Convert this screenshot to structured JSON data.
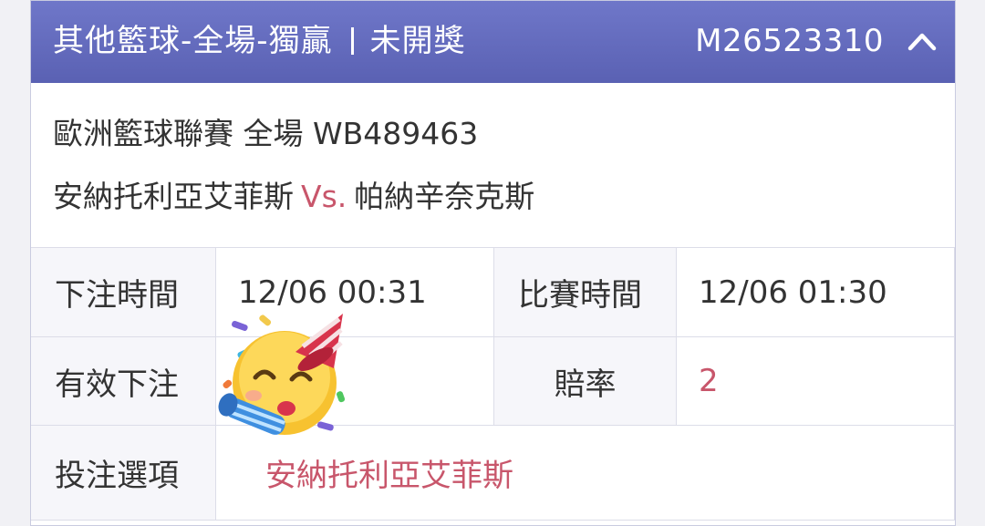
{
  "header": {
    "title": "其他籃球-全場-獨贏",
    "status": "未開獎",
    "code": "M26523310",
    "collapse_icon": "chevron-up-icon"
  },
  "match": {
    "league_line": "歐洲籃球聯賽 全場 WB489463",
    "home_team": "安納托利亞艾菲斯",
    "vs": "Vs.",
    "away_team": "帕納辛奈克斯"
  },
  "details": {
    "bet_time_label": "下注時間",
    "bet_time_value": "12/06 00:31",
    "match_time_label": "比賽時間",
    "match_time_value": "12/06 01:30",
    "valid_bet_label": "有效下注",
    "valid_bet_value": "",
    "odds_label": "賠率",
    "odds_value": "2",
    "selection_label": "投注選項",
    "selection_value": "安納托利亞艾菲斯"
  },
  "sticker": "partying-face-icon",
  "colors": {
    "header_bg": "#5f67b9",
    "accent_red": "#c8566b",
    "label_bg": "#f6f6fa",
    "border": "#dcdde8"
  }
}
